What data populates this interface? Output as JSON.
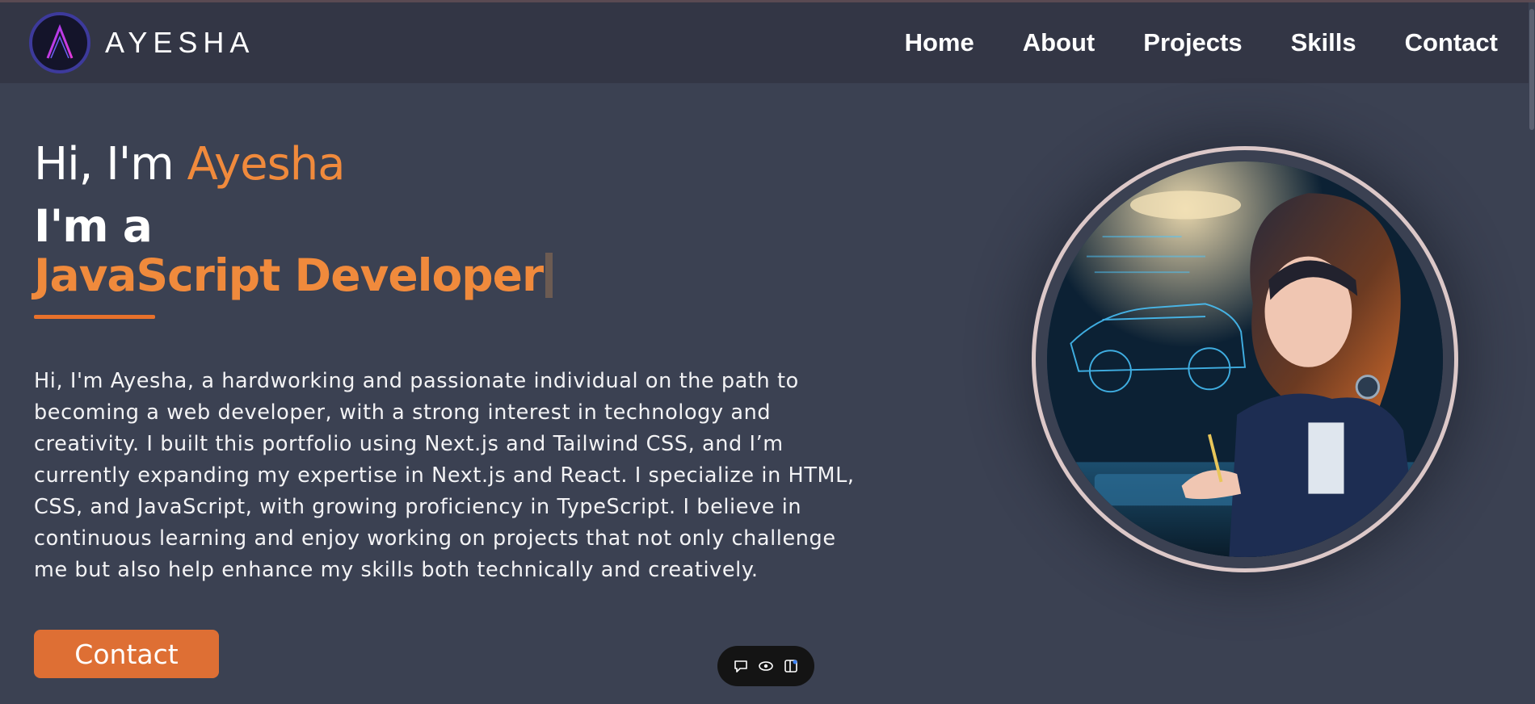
{
  "brand": {
    "name": "AYESHA",
    "logo_icon": "letter-a-logo-icon"
  },
  "nav": {
    "items": [
      "Home",
      "About",
      "Projects",
      "Skills",
      "Contact"
    ]
  },
  "hero": {
    "greeting_prefix": "Hi, I'm ",
    "greeting_name": "Ayesha",
    "intro": "I'm a",
    "role": "JavaScript Developer",
    "bio": "Hi, I'm Ayesha, a hardworking and passionate individual on the path to becoming a web developer, with a strong interest in technology and creativity. I built this portfolio using Next.js and Tailwind CSS, and I’m currently expanding my expertise in Next.js and React. I specialize in HTML, CSS, and JavaScript, with growing proficiency in TypeScript. I believe in continuous learning and enjoy working on projects that not only challenge me but also help enhance my skills both technically and creatively.",
    "cta_label": "Contact"
  },
  "portrait": {
    "alt": "illustration-of-developer-drawing-car-blueprint"
  },
  "toolbar": {
    "icons": [
      "comment-icon",
      "eye-icon",
      "sidebar-panel-icon"
    ]
  },
  "colors": {
    "accent": "#f08a3c",
    "button": "#de6f34",
    "background": "#3b4152",
    "nav_background": "#333645",
    "portrait_ring": "#dcc8c8"
  }
}
